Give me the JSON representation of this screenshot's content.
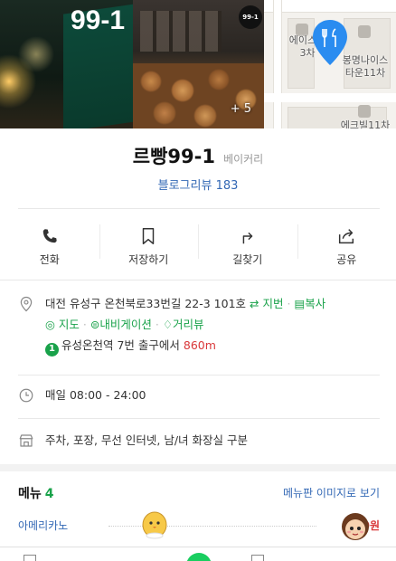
{
  "gallery": {
    "photo1_sign": "99-1",
    "photo2_badge": "99-1",
    "more_photos": "+ 5",
    "map_labels": [
      "에이스타\n3차",
      "봉명나이스\n타운11차",
      "에크빌11차"
    ]
  },
  "place": {
    "name": "르빵99-1",
    "category": "베이커리",
    "blog_review_label": "블로그리뷰",
    "blog_review_count": "183"
  },
  "actions": [
    {
      "label": "전화",
      "icon": "phone-icon"
    },
    {
      "label": "저장하기",
      "icon": "bookmark-icon"
    },
    {
      "label": "길찾기",
      "icon": "directions-icon"
    },
    {
      "label": "공유",
      "icon": "share-icon"
    }
  ],
  "address": {
    "text": "대전 유성구 온천북로33번길 22-3 101호",
    "jibun": "지번",
    "copy": "복사",
    "map": "지도",
    "navigation": "내비게이션",
    "streetview": "거리뷰",
    "station_number": "1",
    "station": "유성온천역 7번 출구에서",
    "distance": "860m"
  },
  "hours": {
    "text": "매일 08:00 - 24:00"
  },
  "facilities": {
    "text": "주차, 포장, 무선 인터넷, 남/녀 화장실 구분"
  },
  "menu": {
    "title": "메뉴",
    "count": "4",
    "board_link": "메뉴판 이미지로 보기",
    "items": [
      {
        "name": "아메리카노",
        "price": "3,0원"
      }
    ]
  },
  "colors": {
    "green": "#19a24a",
    "blue": "#3368b5",
    "red": "#d9383a"
  }
}
